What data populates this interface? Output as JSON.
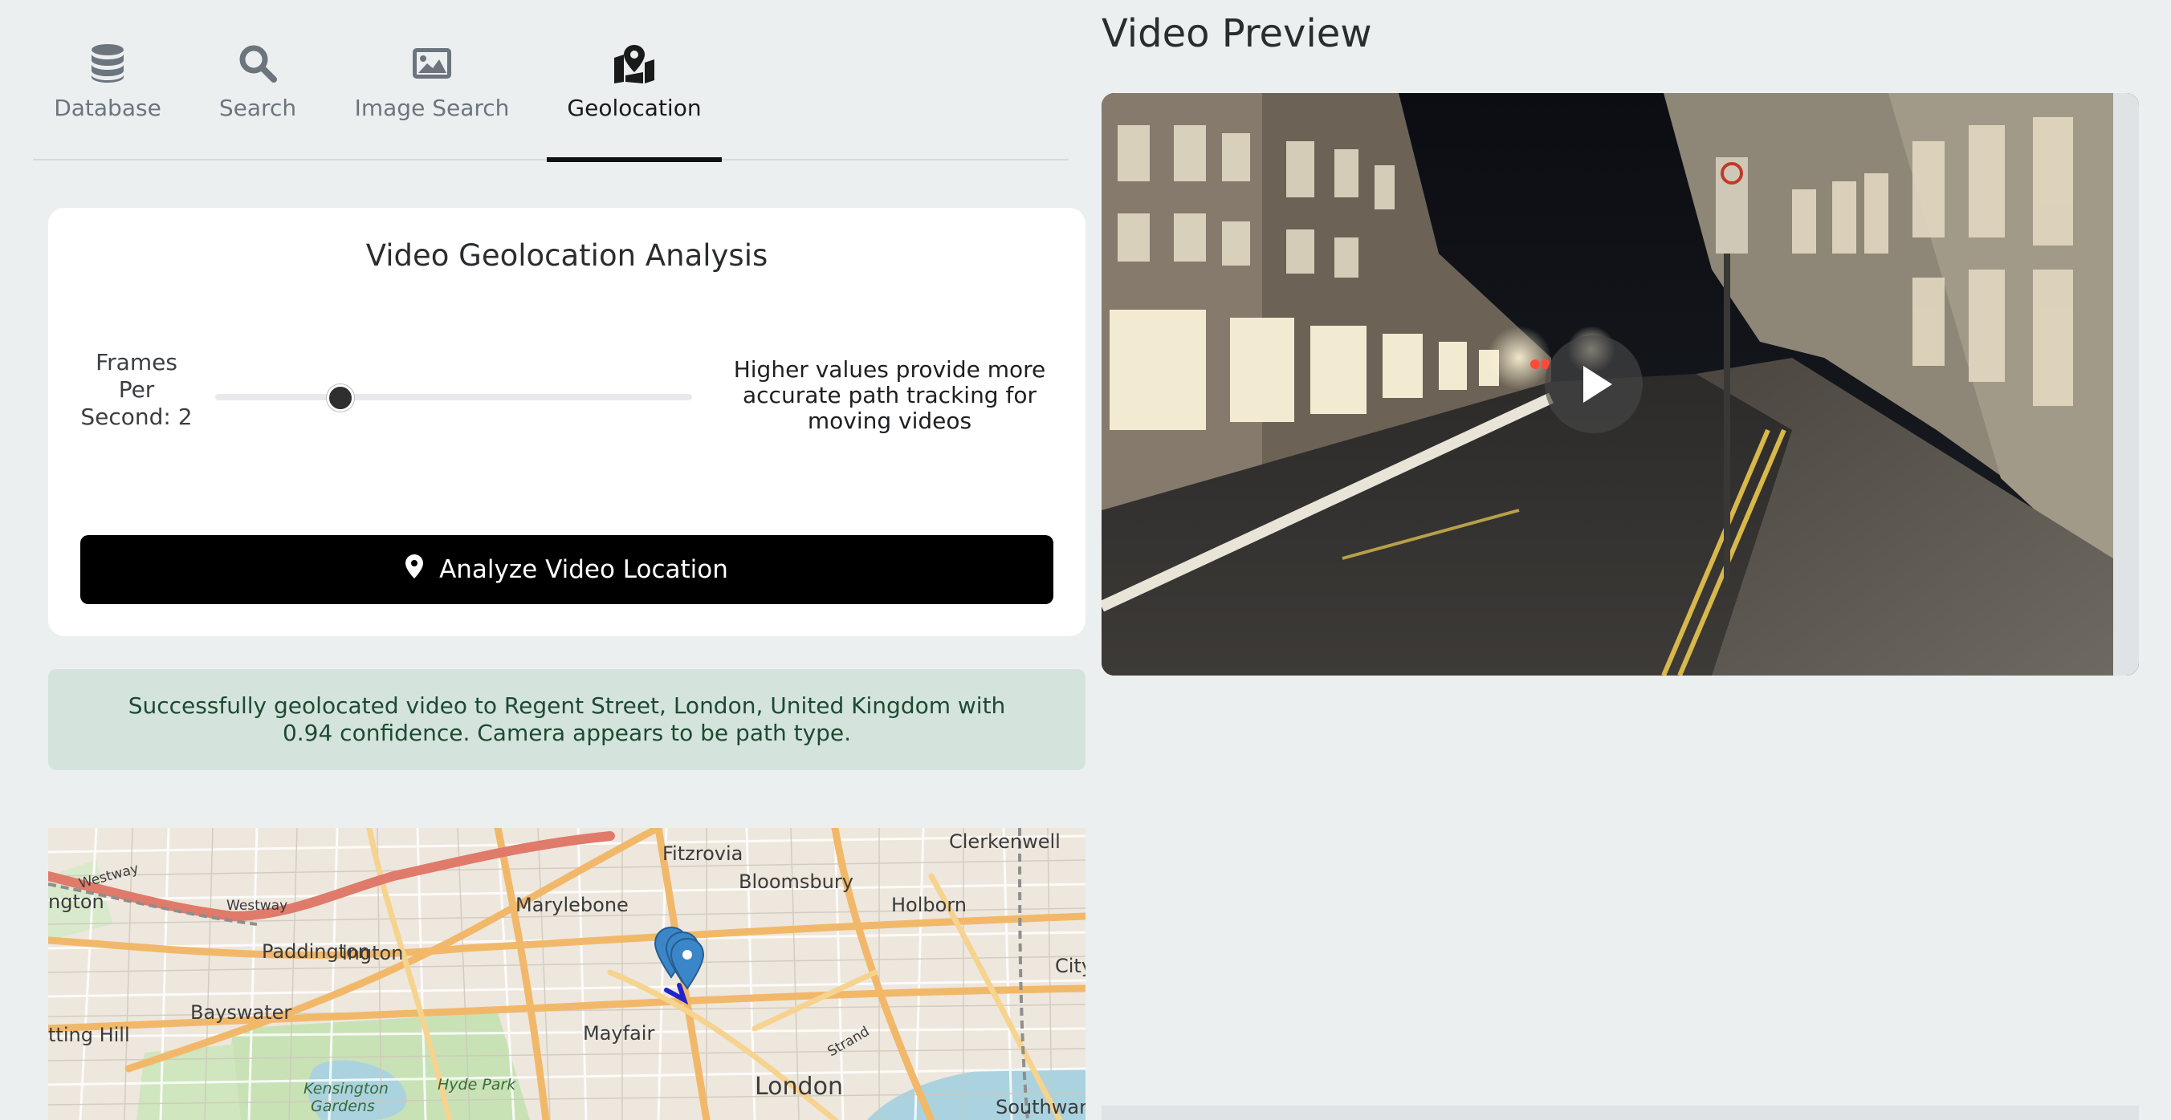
{
  "tabs": [
    {
      "label": "Database",
      "icon": "database-icon",
      "active": false
    },
    {
      "label": "Search",
      "icon": "search-icon",
      "active": false
    },
    {
      "label": "Image Search",
      "icon": "image-icon",
      "active": false
    },
    {
      "label": "Geolocation",
      "icon": "map-pin-icon",
      "active": true
    }
  ],
  "analysis": {
    "title": "Video Geolocation Analysis",
    "fps_label_lines": [
      "Frames",
      "Per",
      "Second: 2"
    ],
    "fps_value": 2,
    "fps_hint": "Higher values provide more accurate path tracking for moving videos",
    "analyze_button": "Analyze Video Location"
  },
  "alert": {
    "text": "Successfully geolocated video to Regent Street, London, United Kingdom with 0.94 confidence. Camera appears to be path type."
  },
  "map": {
    "labels": {
      "clerkenwell": "Clerkenwell",
      "fitzrovia": "Fitzrovia",
      "bloomsbury": "Bloomsbury",
      "westway": "Westway",
      "ngton": "ngton",
      "westway2": "Westway",
      "marylebone": "Marylebone",
      "holborn": "Holborn",
      "paddington": "Paddington",
      "ington": "ington",
      "city": "City",
      "bayswater": "Bayswater",
      "tting_hill": "tting Hill",
      "mayfair": "Mayfair",
      "strand": "Strand",
      "hyde_park": "Hyde Park",
      "kensington": "Kensington",
      "gardens": "Gardens",
      "london": "London",
      "southwark": "Southwar"
    }
  },
  "preview": {
    "heading": "Video Preview"
  },
  "colors": {
    "background": "#ebeff0",
    "button": "#000000",
    "alert_bg": "#d4e4dc",
    "alert_text": "#1d4a32",
    "marker": "#3a86c8"
  }
}
